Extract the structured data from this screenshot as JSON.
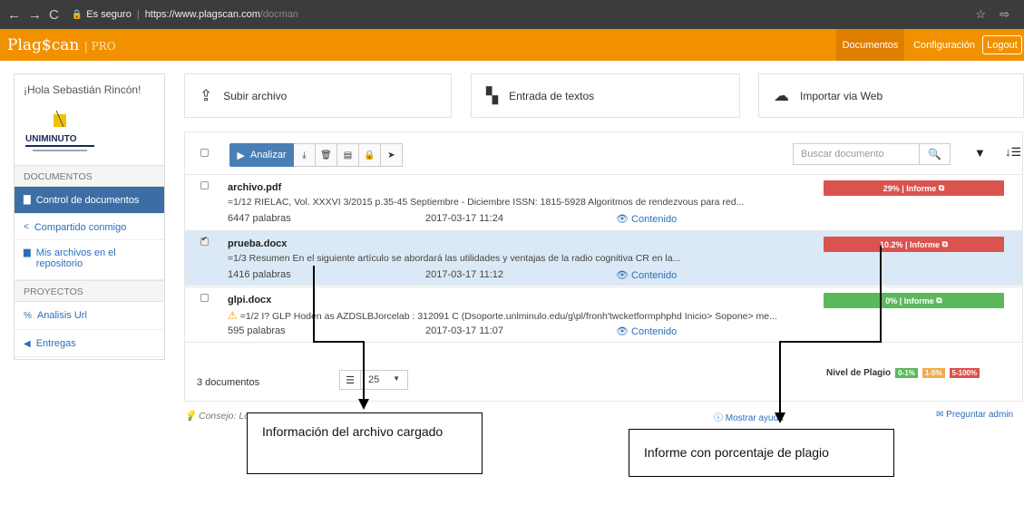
{
  "browser": {
    "security": "Es seguro",
    "url_base": "https://www.plagscan.com",
    "url_path": "/docman"
  },
  "header": {
    "logo": "Plag$can",
    "logo_suffix": "PRO",
    "nav_documentos": "Documentos",
    "nav_configuracion": "Configuración",
    "logout": "Logout"
  },
  "sidebar": {
    "greeting": "¡Hola Sebastián Rincón!",
    "org_logo_text": "UNIMINUTO",
    "sections": [
      {
        "title": "DOCUMENTOS"
      },
      {
        "title": "PROYECTOS"
      }
    ],
    "items": [
      {
        "label": "Control de documentos"
      },
      {
        "label": "Compartido conmigo"
      },
      {
        "label": "Mis archivos en el repositorio"
      },
      {
        "label": "Analisis Url"
      },
      {
        "label": "Entregas"
      }
    ]
  },
  "upload": {
    "subir": "Subir archivo",
    "entrada": "Entrada de textos",
    "importar": "Importar via Web"
  },
  "toolbar": {
    "analizar": "Analizar",
    "search_placeholder": "Buscar documento"
  },
  "documents": [
    {
      "name": "archivo.pdf",
      "desc": "=1/12 RIELAC, Vol. XXXVI 3/2015 p.35-45 Septiembre - Diciembre ISSN: 1815-5928 Algoritmos de rendezvous para red...",
      "words": "6447  palabras",
      "date": "2017-03-17 11:24",
      "content": "Contenido",
      "report": "29% | Informe",
      "report_color": "#d9534f",
      "selected": false
    },
    {
      "name": "prueba.docx",
      "desc": "=1/3  Resumen En el siguiente artículo se abordará las utilidades y ventajas de la radio cognitiva CR en la...",
      "words": "1416  palabras",
      "date": "2017-03-17 11:12",
      "content": "Contenido",
      "report": "10.2% | Informe",
      "report_color": "#d9534f",
      "selected": true
    },
    {
      "name": "glpi.docx",
      "desc": "=1/2 I? GLP Hoden as AZDSLBJorcelab : 312091 C (Dsoporte.unlminulo.edu/g\\pl/fronh'twcketformphphd Inicio> Sopone> me...",
      "words": "595  palabras",
      "date": "2017-03-17 11:07",
      "content": "Contenido",
      "report": "0% | Informe",
      "report_color": "#5cb85c",
      "selected": false
    }
  ],
  "footer": {
    "count": "3 documentos",
    "per_page": "25",
    "nivel_label": "Nivel de Plagio",
    "levels": [
      {
        "label": "0-1%",
        "color": "#5cb85c"
      },
      {
        "label": "1-5%",
        "color": "#f0ad4e"
      },
      {
        "label": "5-100%",
        "color": "#d9534f"
      }
    ]
  },
  "bottom": {
    "tip": "Consejo: Lo",
    "help": "Mostrar ayuda",
    "admin": "Preguntar admin"
  },
  "annotations": {
    "file_info": "Información del archivo cargado",
    "report_info": "Informe con porcentaje de plagio"
  },
  "colors": {
    "brand_orange": "#f29100",
    "active_blue": "#3c6ea5"
  }
}
